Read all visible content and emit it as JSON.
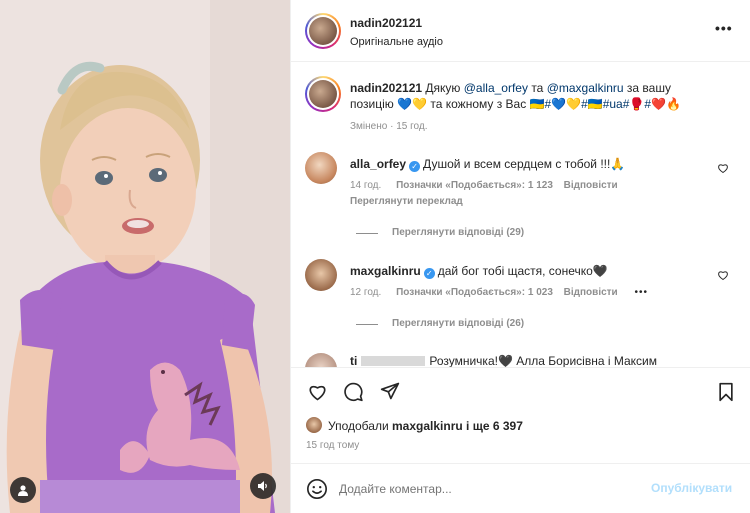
{
  "post": {
    "author": "nadin202121",
    "audio": "Оригінальне аудіо",
    "caption_user": "nadin202121",
    "caption_pre": "Дякую",
    "caption_mention1": "@alla_orfey",
    "caption_mid": "та",
    "caption_mention2": "@maxgalkinru",
    "caption_post": "за вашу",
    "caption_line2a": "позицію",
    "caption_line2b": "та кожному з Вас",
    "caption_hashtags": "🇺🇦#💙💛#🇺🇦#ua#🥊#❤️🔥",
    "caption_meta": "Змінено · 15 год."
  },
  "comments": [
    {
      "user": "alla_orfey",
      "text": "Душой и всем сердцем с тобой !!!🙏",
      "time": "14 год.",
      "likes": "Позначки «Подобається»: 1 123",
      "reply": "Відповісти",
      "translate": "Переглянути переклад",
      "replies": "Переглянути відповіді (29)"
    },
    {
      "user": "maxgalkinru",
      "text": "дай бог тобі щастя, сонечко🖤",
      "time": "12 год.",
      "likes": "Позначки «Подобається»: 1 023",
      "reply": "Відповісти",
      "more": "•••",
      "replies": "Переглянути відповіді (26)"
    },
    {
      "user": "ti",
      "text": "Розумничка!🖤 Алла Борисівна і Максим"
    }
  ],
  "likes": {
    "prefix": "Уподобали",
    "user": "maxgalkinru",
    "suffix": "і ще 6 397",
    "time": "15 год тому"
  },
  "composer": {
    "placeholder": "Додайте коментар...",
    "publish": "Опублікувати"
  },
  "colors": {
    "accent": "#0095f6",
    "publish_disabled": "#b2dffc",
    "verified": "#3897f0",
    "shirt": "#a86bc9"
  }
}
